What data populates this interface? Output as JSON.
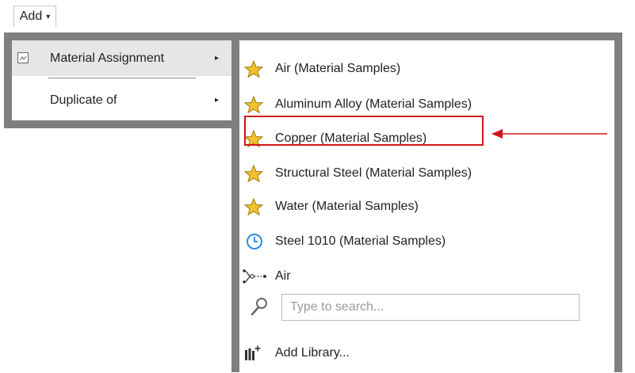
{
  "add_button": {
    "label": "Add",
    "caret": "▾"
  },
  "menu": {
    "items": [
      {
        "label": "Material Assignment",
        "icon": "material-assignment-icon",
        "arrow": "▸",
        "highlighted": true
      },
      {
        "label": "Duplicate of",
        "arrow": "▸",
        "highlighted": false
      }
    ]
  },
  "submenu": {
    "materials": [
      {
        "label": "Air (Material Samples)",
        "icon": "star-icon"
      },
      {
        "label": "Aluminum Alloy (Material Samples)",
        "icon": "star-icon"
      },
      {
        "label": "Copper (Material Samples)",
        "icon": "star-icon",
        "highlighted": true
      },
      {
        "label": "Structural Steel (Material Samples)",
        "icon": "star-icon"
      },
      {
        "label": "Water (Material Samples)",
        "icon": "star-icon"
      },
      {
        "label": "Steel 1010 (Material Samples)",
        "icon": "clock-icon"
      }
    ],
    "link_item": {
      "label": "Air",
      "icon": "link-nodes-icon"
    },
    "search": {
      "placeholder": "Type to search...",
      "value": "",
      "icon": "search-icon"
    },
    "add_library": {
      "label": "Add Library...",
      "icon": "add-library-icon"
    }
  },
  "colors": {
    "menu_border": "#7f7f7f",
    "highlight_bg": "#e6e6e6",
    "callout_red": "#d0161c",
    "star_fill": "#f2c12e",
    "clock_blue": "#2d8ae6"
  }
}
